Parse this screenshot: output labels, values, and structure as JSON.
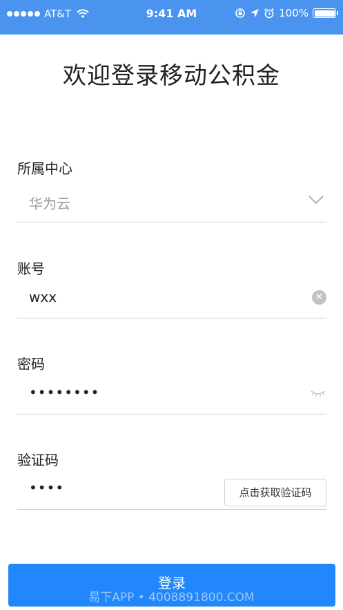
{
  "status_bar": {
    "carrier": "AT&T",
    "time": "9:41 AM",
    "battery": "100%"
  },
  "page_title": "欢迎登录移动公积金",
  "form": {
    "center": {
      "label": "所属中心",
      "value": "华为云"
    },
    "account": {
      "label": "账号",
      "value": "wxx"
    },
    "password": {
      "label": "密码",
      "value": "••••••••"
    },
    "captcha": {
      "label": "验证码",
      "value": "••••",
      "button": "点击获取验证码"
    }
  },
  "login_button": "登录",
  "watermark": "易下APP • 4008891800.COM"
}
